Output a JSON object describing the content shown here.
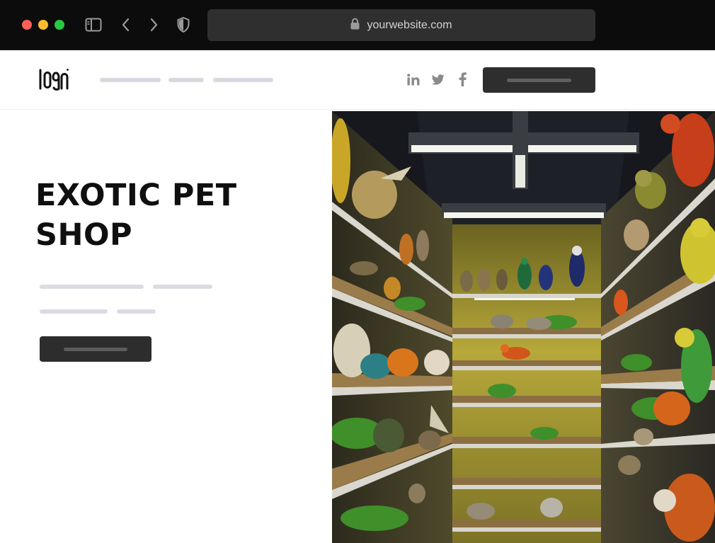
{
  "browser": {
    "url": "yourwebsite.com",
    "buttons": [
      "sidebar-toggle",
      "back",
      "forward",
      "privacy-shield"
    ]
  },
  "header": {
    "logo_text": "LOGO",
    "social": [
      "linkedin",
      "twitter",
      "facebook"
    ]
  },
  "hero": {
    "title": "EXOTIC PET SHOP"
  },
  "colors": {
    "chrome_bg": "#0c0c0c",
    "address_bar": "#2f2f2f",
    "placeholder_bar": "#dcdbe3",
    "button_dark": "#2e2e2e",
    "wall_yellow": "#a8992c",
    "light_tube": "#f4f6ee"
  },
  "icons": {
    "sidebar": "sidebar-icon",
    "back": "chevron-left-icon",
    "forward": "chevron-right-icon",
    "shield": "shield-icon",
    "lock": "lock-icon",
    "linkedin": "linkedin-icon",
    "twitter": "twitter-icon",
    "facebook": "facebook-icon"
  }
}
